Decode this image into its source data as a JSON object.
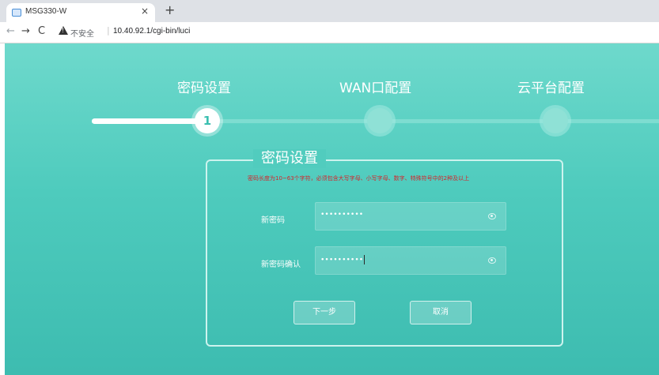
{
  "browser": {
    "tab_title": "MSG330-W",
    "tab_close": "×",
    "new_tab": "+",
    "nav_back": "←",
    "nav_forward": "→",
    "nav_reload": "C",
    "insecure_label": "不安全",
    "separator": "|",
    "url": "10.40.92.1/cgi-bin/luci"
  },
  "steps": [
    {
      "label": "密码设置",
      "number": "1",
      "active": true
    },
    {
      "label": "WAN口配置",
      "number": "",
      "active": false
    },
    {
      "label": "云平台配置",
      "number": "",
      "active": false
    }
  ],
  "form": {
    "title": "密码设置",
    "note": "密码长度为10~63个字符，必须包含大写字母、小写字母、数字、特殊符号中的2种及以上",
    "new_password_label": "新密码",
    "new_password_value": "••••••••••",
    "confirm_password_label": "新密码确认",
    "confirm_password_value": "••••••••••",
    "next_button": "下一步",
    "cancel_button": "取消"
  },
  "colors": {
    "accent": "#4ecbbd",
    "note_red": "#d4242b"
  },
  "icons": {
    "password_toggle": "eye-icon",
    "security_warning": "warning-icon"
  }
}
